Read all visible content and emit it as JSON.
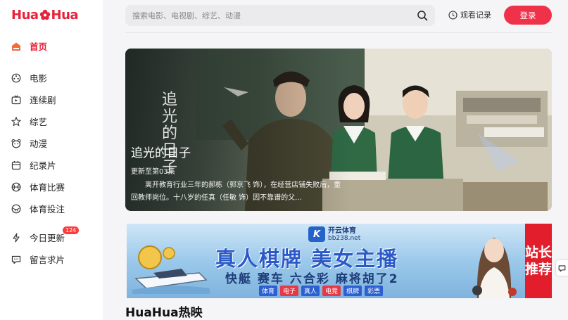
{
  "app": {
    "logo_text_left": "Hua",
    "logo_text_right": "Hua",
    "brand_color": "#e8213a"
  },
  "sidebar": {
    "items": [
      {
        "label": "首页",
        "icon": "home-icon",
        "active": true
      },
      {
        "label": "电影",
        "icon": "film-reel-icon"
      },
      {
        "label": "连续剧",
        "icon": "tv-icon"
      },
      {
        "label": "综艺",
        "icon": "star-icon"
      },
      {
        "label": "动漫",
        "icon": "bear-face-icon"
      },
      {
        "label": "纪录片",
        "icon": "calendar-icon"
      },
      {
        "label": "体育比赛",
        "icon": "basketball-icon"
      },
      {
        "label": "体育投注",
        "icon": "soccer-icon"
      },
      {
        "label": "今日更新",
        "icon": "lightning-icon",
        "badge": "124"
      },
      {
        "label": "留言求片",
        "icon": "message-icon"
      }
    ]
  },
  "header": {
    "search_placeholder": "搜索电影、电视剧、综艺、动漫",
    "history_label": "观看记录",
    "login_label": "登录"
  },
  "hero": {
    "title": "追光的日子",
    "subtitle": "更新至第03集",
    "description": "离开教育行业三年的郝栋（郭京飞 饰），在经营店铺失败后，重回教师岗位。十八岁的任真（任敏 饰）因不靠谱的父...",
    "calligraphy": "追光的日子"
  },
  "ad": {
    "brand_logo": "K",
    "brand_name": "开云体育",
    "brand_url": "bb238.net",
    "headline": "真人棋牌 美女主播",
    "subline": "快艇 赛车 六合彩 麻将胡了2",
    "tags": [
      "体育",
      "电子",
      "真人",
      "电竞",
      "棋牌",
      "彩票"
    ],
    "side_text_1": "站长",
    "side_text_2": "推荐"
  },
  "section": {
    "title": "HuaHua热映"
  }
}
